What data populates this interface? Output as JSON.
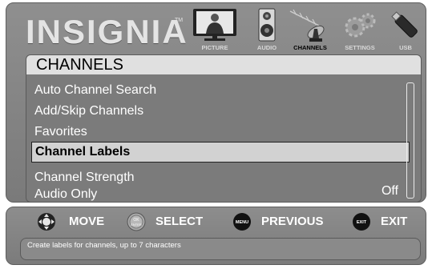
{
  "brand": {
    "logo": "INSIGNIA",
    "tm": "TM"
  },
  "tabs": [
    {
      "label": "PICTURE",
      "icon": "tv-picture-icon"
    },
    {
      "label": "AUDIO",
      "icon": "speaker-icon"
    },
    {
      "label": "CHANNELS",
      "icon": "antenna-icon",
      "active": true
    },
    {
      "label": "SETTINGS",
      "icon": "gears-icon"
    },
    {
      "label": "USB",
      "icon": "usb-drive-icon"
    }
  ],
  "submenu": {
    "title": "CHANNELS",
    "items": [
      {
        "label": "Auto Channel Search"
      },
      {
        "label": "Add/Skip Channels"
      },
      {
        "label": "Favorites"
      },
      {
        "label": "Channel Labels",
        "selected": true
      },
      {
        "label": "Channel Strength"
      },
      {
        "label": "Audio Only",
        "value": "Off"
      }
    ]
  },
  "help": {
    "move": "MOVE",
    "select": "SELECT",
    "select_icon_top": "OK",
    "select_icon_bottom": "ENTER",
    "previous": "PREVIOUS",
    "previous_icon": "MENU",
    "exit": "EXIT",
    "exit_icon": "EXIT",
    "description": "Create labels for channels, up to 7 characters"
  },
  "colors": {
    "panel": "#7b7b7b",
    "selected": "#d2d2d2",
    "title_bg": "#e0e0e0"
  }
}
